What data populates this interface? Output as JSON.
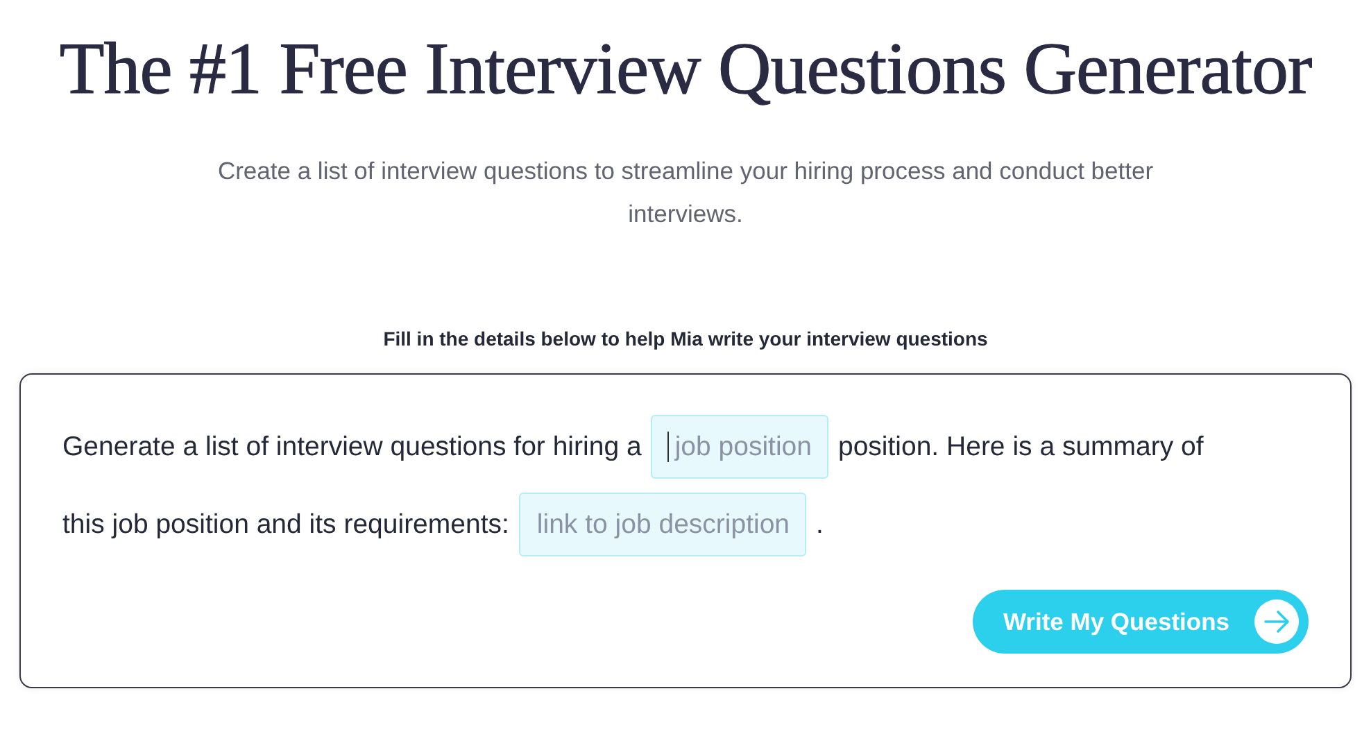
{
  "title": "The #1 Free Interview Questions Generator",
  "subtitle": "Create a list of interview questions to streamline your hiring process and conduct better interviews.",
  "form_label": "Fill in the details below to help Mia write your interview questions",
  "form": {
    "lines": [
      [
        {
          "kind": "text",
          "text": "Generate a list of interview questions for hiring a"
        },
        {
          "kind": "field",
          "placeholder": "job position",
          "focused": true
        },
        {
          "kind": "text",
          "text": "position. Here is a summary of"
        }
      ],
      [
        {
          "kind": "text",
          "text": "this job position and its requirements:"
        },
        {
          "kind": "field",
          "placeholder": "link to job description",
          "focused": false
        },
        {
          "kind": "text",
          "text": "."
        }
      ]
    ],
    "button": "Write My Questions"
  }
}
